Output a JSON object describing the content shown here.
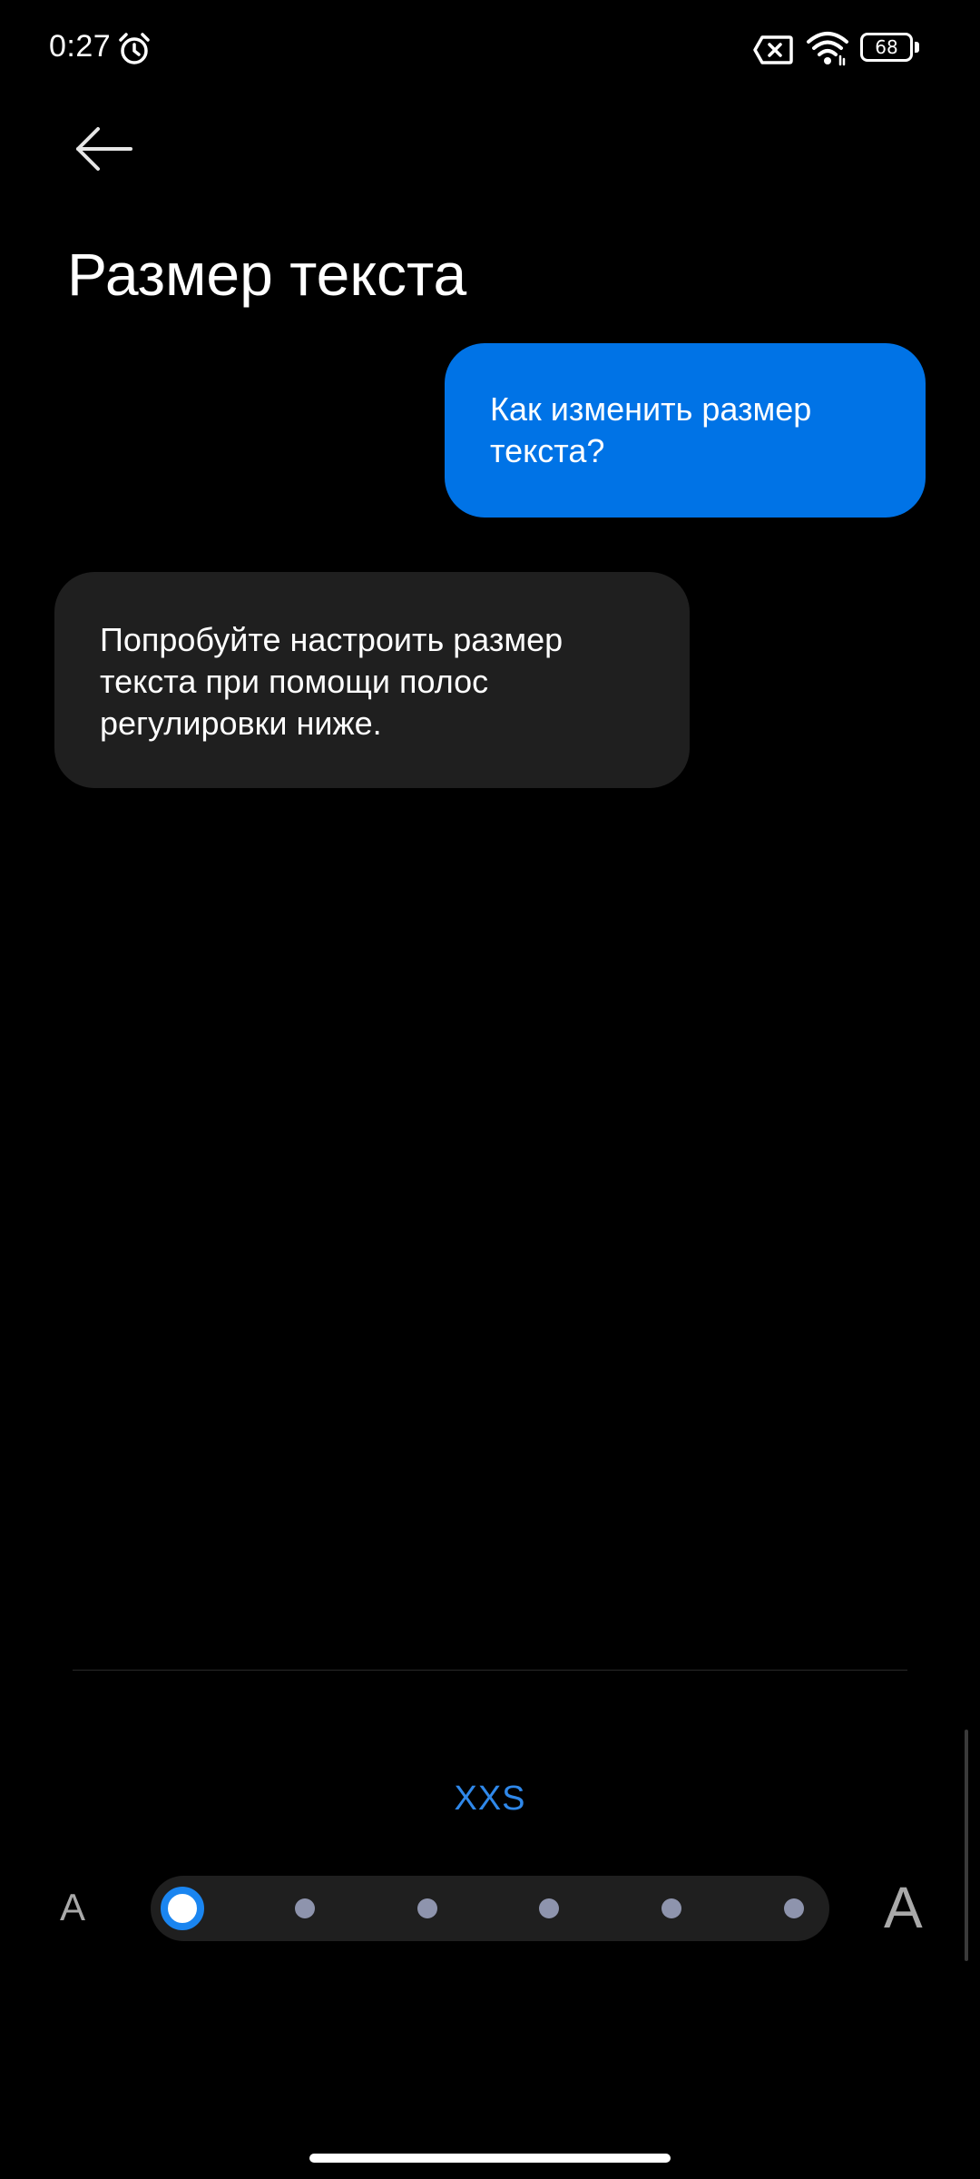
{
  "status_bar": {
    "time": "0:27",
    "battery_level": "68",
    "icons": [
      "alarm-icon",
      "sim-x-icon",
      "wifi-icon",
      "battery-icon"
    ]
  },
  "header": {
    "back_icon": "arrow-left-icon",
    "title": "Размер текста"
  },
  "chat": {
    "question": "Как изменить размер текста?",
    "answer": "Попробуйте настроить размер текста при помощи полос регулировки ниже."
  },
  "text_size": {
    "current_label": "XXS",
    "small_glyph": "A",
    "large_glyph": "A",
    "steps": 6,
    "selected_index": 0
  },
  "colors": {
    "background": "#000000",
    "accent": "#0073e6",
    "label_accent": "#2f88ea",
    "answer_bubble": "#1f1f1f",
    "slider_dot": "#8e94ad"
  }
}
